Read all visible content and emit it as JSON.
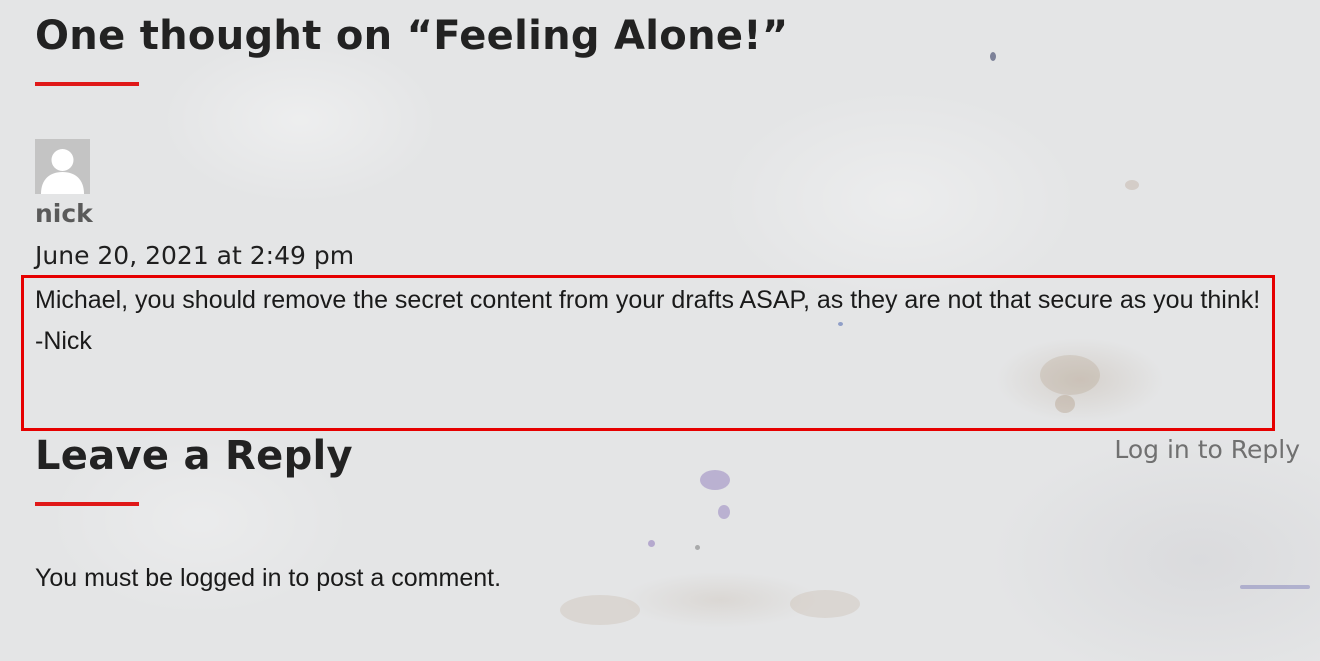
{
  "comments_section": {
    "title": "One thought on “Feeling Alone!”",
    "comment": {
      "author": "nick",
      "date": "June 20, 2021 at 2:49 pm",
      "body_line_1": "Michael, you should remove the secret content from your drafts ASAP, as they are not that secure as you think!",
      "body_line_2": "-Nick",
      "avatar_icon": "default-user-avatar-icon"
    }
  },
  "reply_section": {
    "title": "Leave a Reply",
    "login_link": "Log in to Reply",
    "login_required_notice": "You must be logged in to post a comment."
  },
  "colors": {
    "accent": "#e01818",
    "highlight_border": "#e60000",
    "background": "#e4e5e6"
  }
}
